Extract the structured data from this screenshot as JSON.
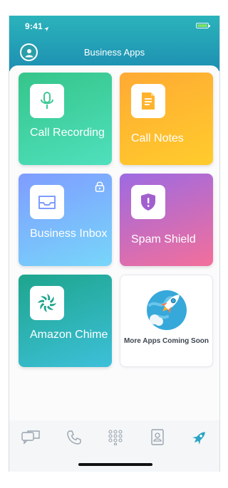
{
  "status_bar": {
    "time": "9:41"
  },
  "header": {
    "title": "Business Apps"
  },
  "tiles": [
    {
      "label": "Call Recording",
      "icon": "microphone-icon"
    },
    {
      "label": "Call Notes",
      "icon": "notes-icon"
    },
    {
      "label": "Business Inbox",
      "icon": "inbox-tray-icon",
      "locked": true
    },
    {
      "label": "Spam Shield",
      "icon": "shield-alert-icon"
    },
    {
      "label": "Amazon Chime",
      "icon": "chime-logo-icon"
    }
  ],
  "more_apps": {
    "label": "More Apps Coming Soon",
    "icon": "rocket-icon"
  },
  "tabbar": {
    "items": [
      "messages-icon",
      "phone-icon",
      "keypad-icon",
      "contacts-icon",
      "rocket-icon"
    ],
    "active": "rocket-icon"
  },
  "colors": {
    "header_start": "#2bb3bb",
    "header_end": "#1d8fb2",
    "accent": "#2aa3c4"
  }
}
